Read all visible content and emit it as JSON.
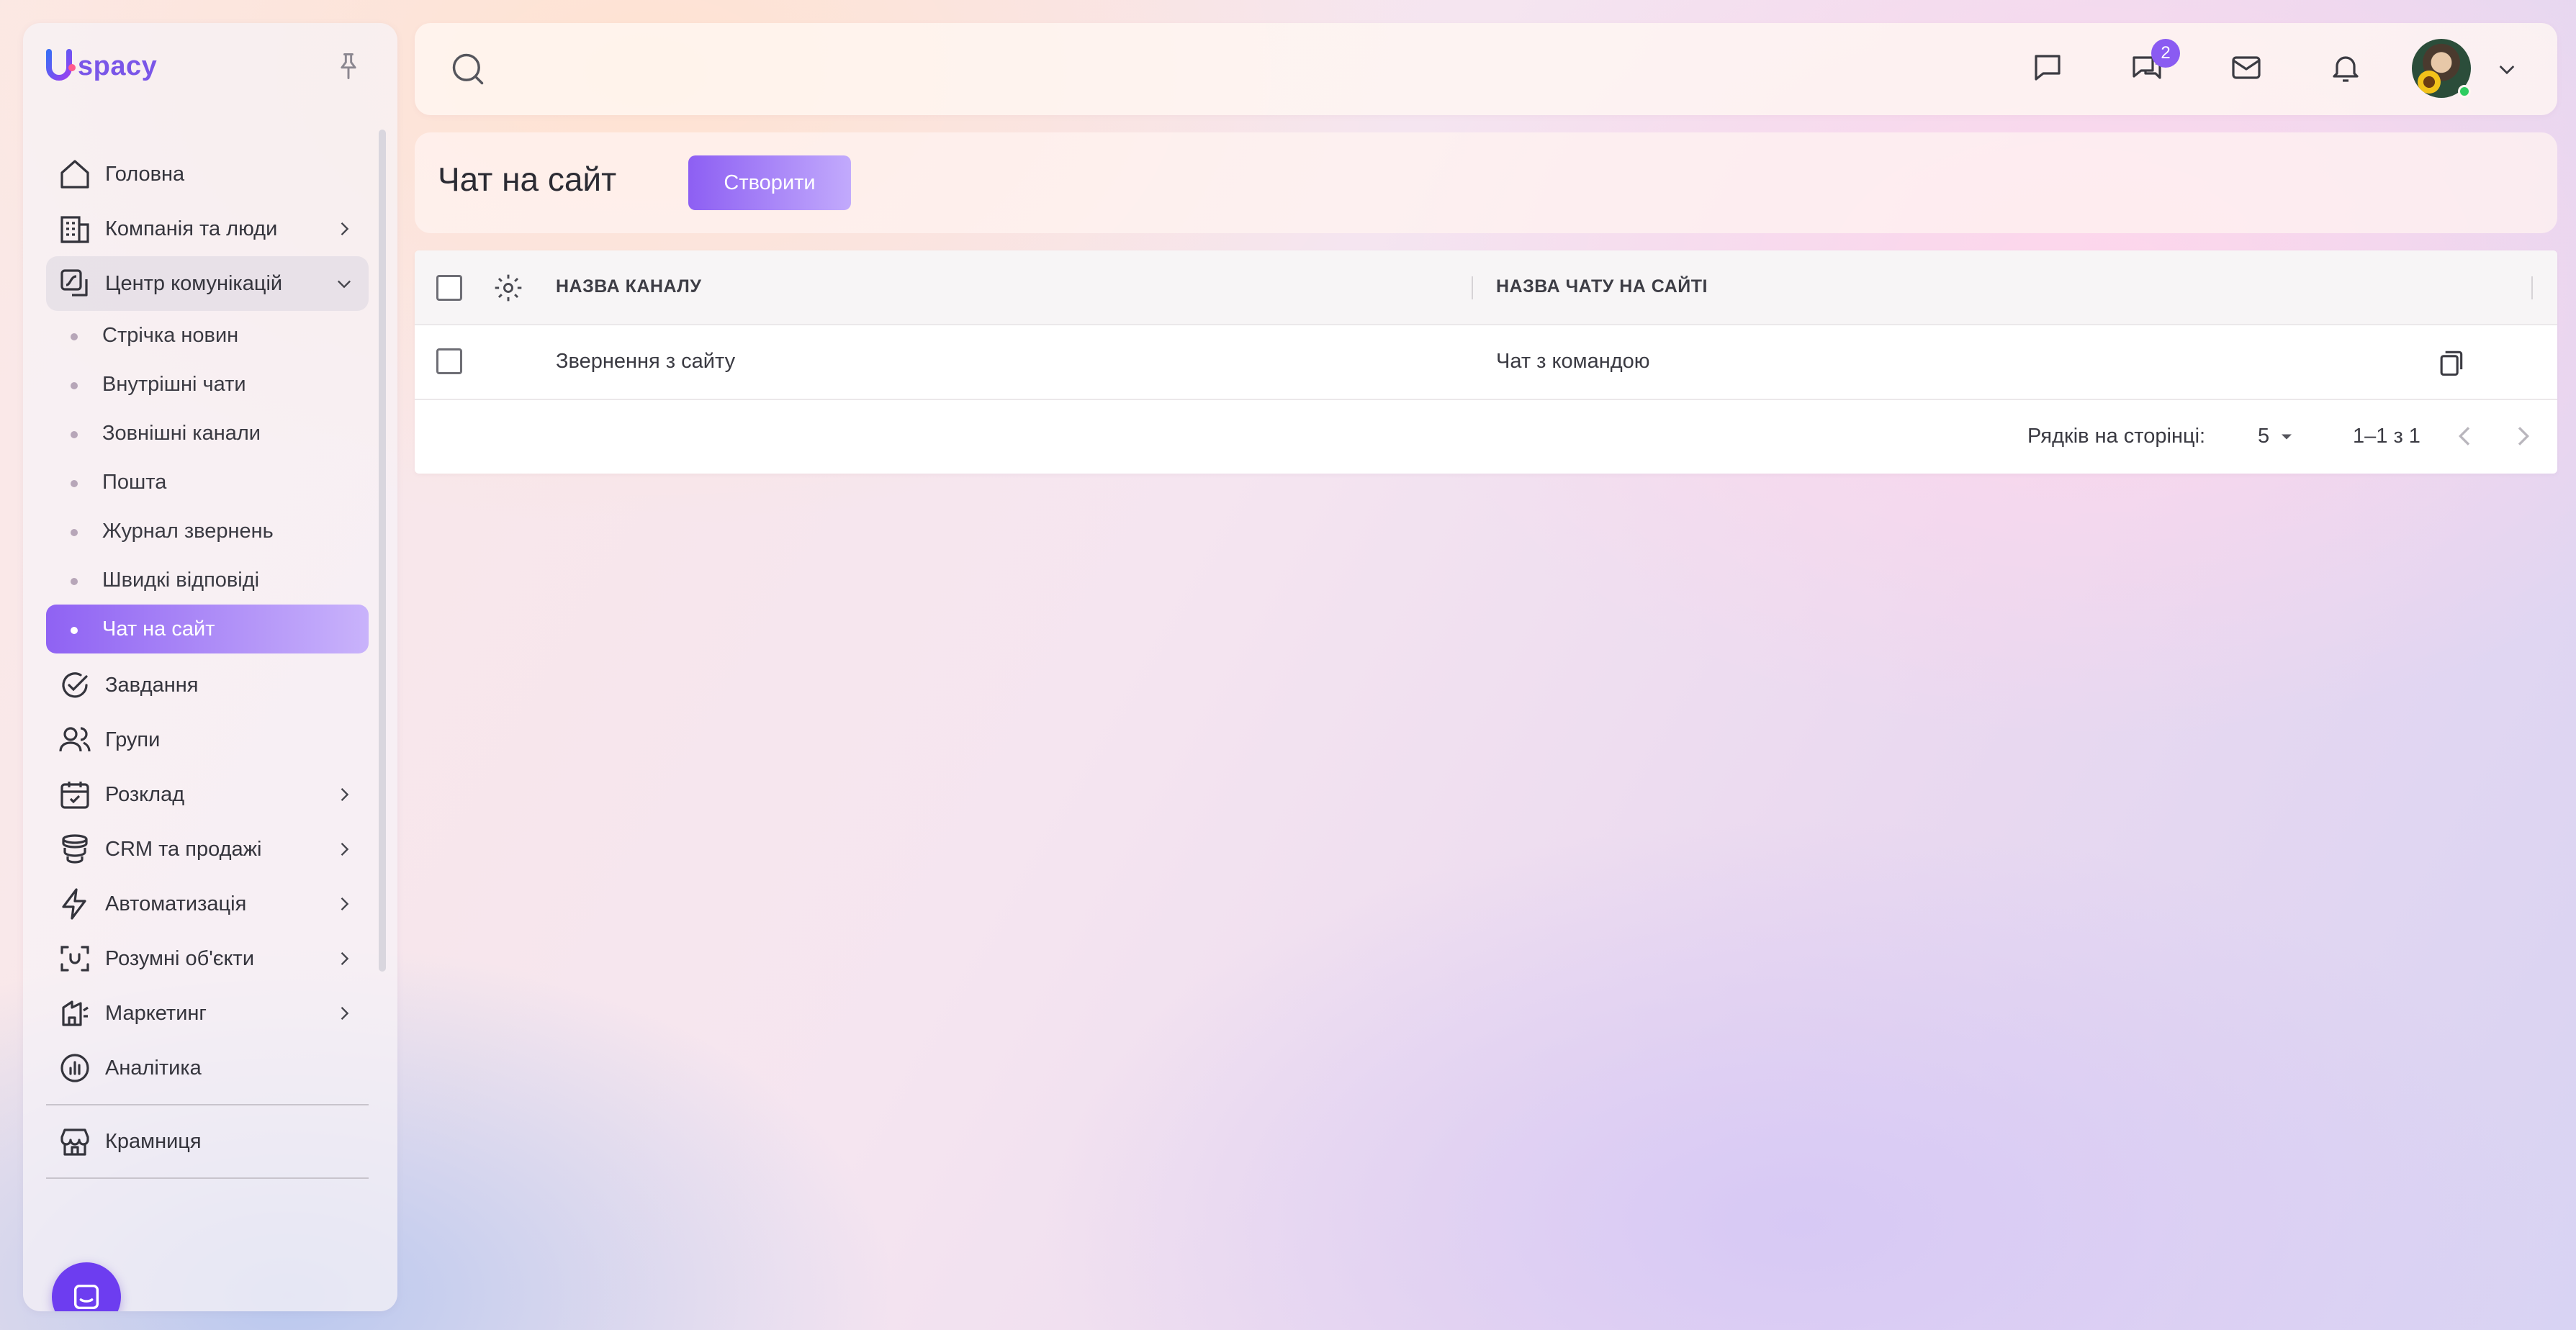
{
  "app": {
    "logo_text": "spacy"
  },
  "sidebar": {
    "items": [
      {
        "label": "Головна",
        "icon": "home-icon"
      },
      {
        "label": "Компанія та люди",
        "icon": "building-icon",
        "has_children": true
      },
      {
        "label": "Центр комунікацій",
        "icon": "communication-icon",
        "expanded": true,
        "children": [
          {
            "label": "Стрічка новин"
          },
          {
            "label": "Внутрішні чати"
          },
          {
            "label": "Зовнішні канали"
          },
          {
            "label": "Пошта"
          },
          {
            "label": "Журнал звернень"
          },
          {
            "label": "Швидкі відповіді"
          },
          {
            "label": "Чат на сайт",
            "active": true
          }
        ]
      },
      {
        "label": "Завдання",
        "icon": "check-circle-icon"
      },
      {
        "label": "Групи",
        "icon": "users-icon"
      },
      {
        "label": "Розклад",
        "icon": "calendar-icon",
        "has_children": true
      },
      {
        "label": "CRM та продажі",
        "icon": "coins-icon",
        "has_children": true
      },
      {
        "label": "Автоматизація",
        "icon": "lightning-icon",
        "has_children": true
      },
      {
        "label": "Розумні об'єкти",
        "icon": "scan-icon",
        "has_children": true
      },
      {
        "label": "Маркетинг",
        "icon": "marketing-icon",
        "has_children": true
      },
      {
        "label": "Аналітика",
        "icon": "analytics-icon"
      },
      {
        "label": "Крамниця",
        "icon": "store-icon"
      }
    ]
  },
  "header": {
    "search_icon": "search-icon",
    "chat_badge": "2"
  },
  "page": {
    "title": "Чат на сайт",
    "create_label": "Створити"
  },
  "table": {
    "columns": [
      "НАЗВА КАНАЛУ",
      "НАЗВА ЧАТУ НА САЙТІ"
    ],
    "rows": [
      {
        "channel": "Звернення з сайту",
        "chat": "Чат з командою"
      }
    ],
    "rows_per_page_label": "Рядків на сторінці:",
    "rows_per_page": "5",
    "range": "1–1 з 1"
  },
  "colors": {
    "accent": "#8a5bf2",
    "accent_light": "#c9b3fb",
    "chat_bubble": "#6d3df0",
    "online": "#2ecc5f"
  }
}
